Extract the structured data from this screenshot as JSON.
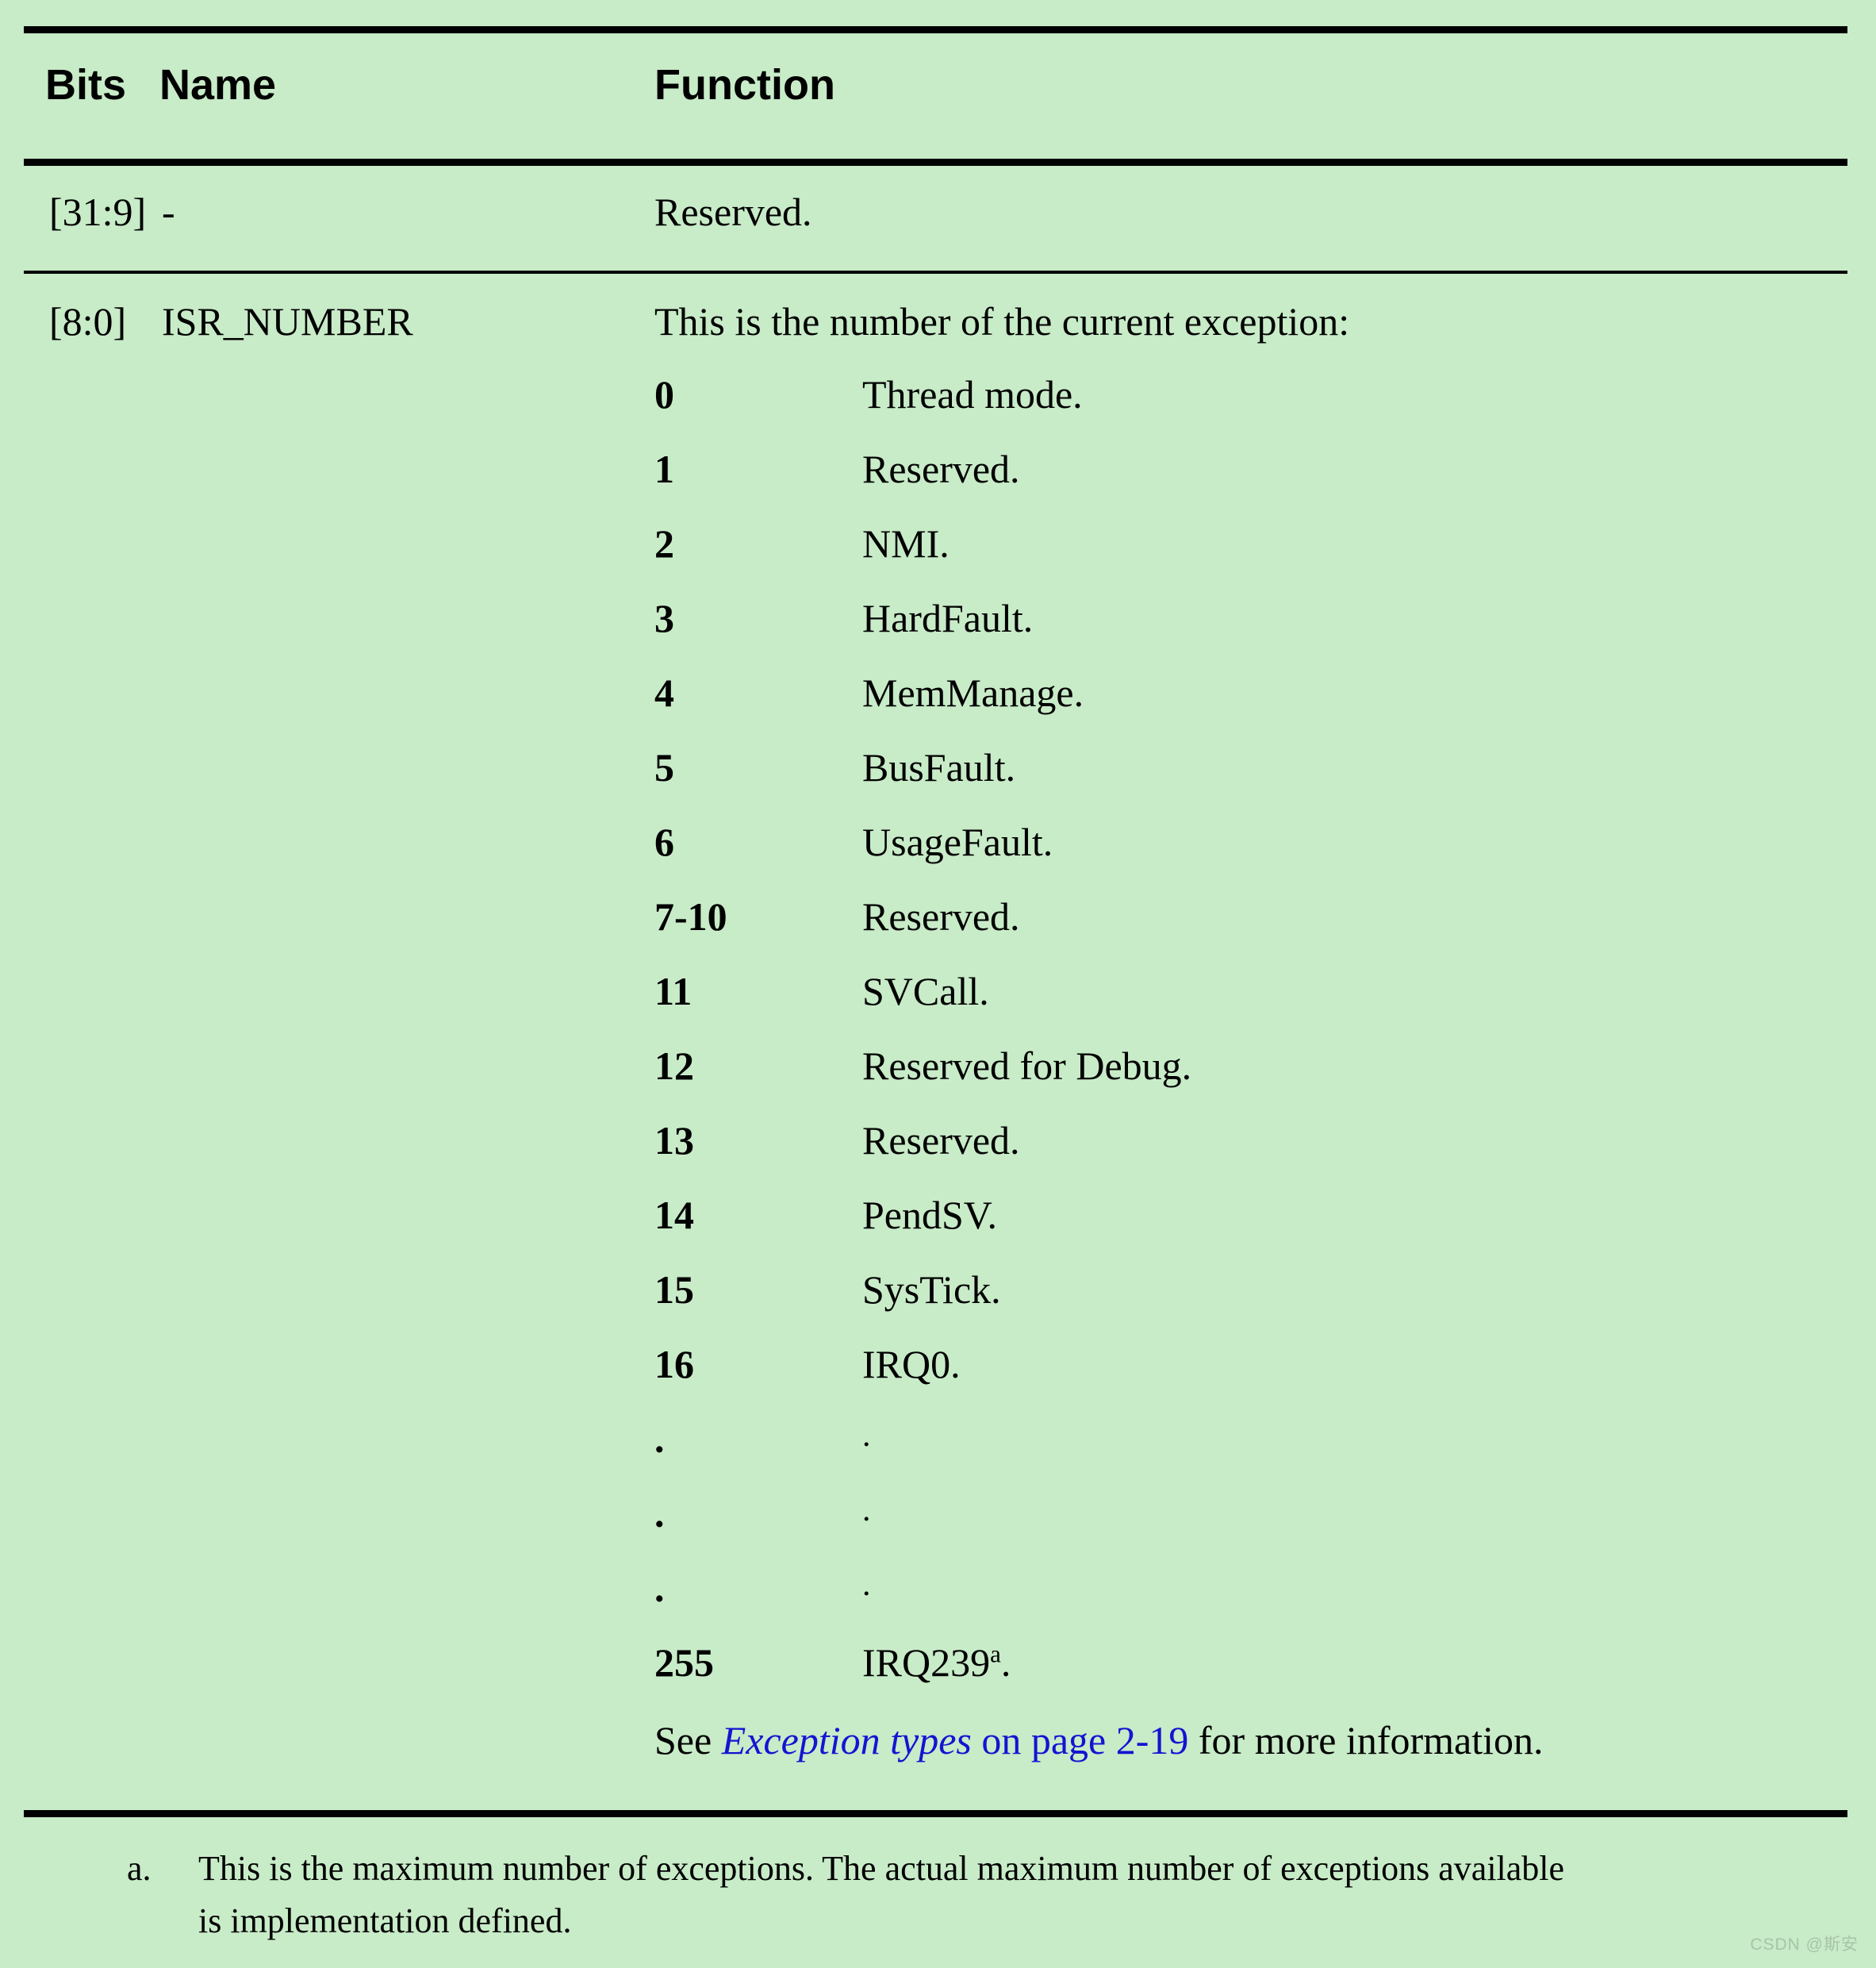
{
  "table": {
    "headers": {
      "bits": "Bits",
      "name": "Name",
      "function": "Function"
    },
    "rows": [
      {
        "bits": "[31:9]",
        "name": "-",
        "function": "Reserved."
      },
      {
        "bits": "[8:0]",
        "name": "ISR_NUMBER",
        "function_intro": "This is the number of the current exception:"
      }
    ]
  },
  "exceptions": [
    {
      "number": "0",
      "description": "Thread mode."
    },
    {
      "number": "1",
      "description": "Reserved."
    },
    {
      "number": "2",
      "description": "NMI."
    },
    {
      "number": "3",
      "description": "HardFault."
    },
    {
      "number": "4",
      "description": "MemManage."
    },
    {
      "number": "5",
      "description": "BusFault."
    },
    {
      "number": "6",
      "description": "UsageFault."
    },
    {
      "number": "7-10",
      "description": "Reserved."
    },
    {
      "number": "11",
      "description": "SVCall."
    },
    {
      "number": "12",
      "description": "Reserved for Debug."
    },
    {
      "number": "13",
      "description": "Reserved."
    },
    {
      "number": "14",
      "description": "PendSV."
    },
    {
      "number": "15",
      "description": "SysTick."
    },
    {
      "number": "16",
      "description": "IRQ0."
    },
    {
      "number": ".",
      "description": "."
    },
    {
      "number": ".",
      "description": "."
    },
    {
      "number": ".",
      "description": "."
    },
    {
      "number": "255",
      "description": "IRQ239",
      "superscript": "a",
      "description_suffix": "."
    }
  ],
  "see_also": {
    "lead": "See ",
    "link_italic": "Exception types",
    "link_plain": " on page 2-19",
    "tail": " for more information.",
    "link_color": "#1414d2"
  },
  "footnote": {
    "marker": "a.",
    "text": "This is the maximum number of exceptions. The actual maximum number of exceptions available is implementation defined."
  },
  "watermark": {
    "text": "CSDN @斯安"
  },
  "colors": {
    "background": "#c8ebc8",
    "text": "#000000",
    "rule": "#000000",
    "link": "#1414d2",
    "watermark": "#a9c4a9"
  }
}
